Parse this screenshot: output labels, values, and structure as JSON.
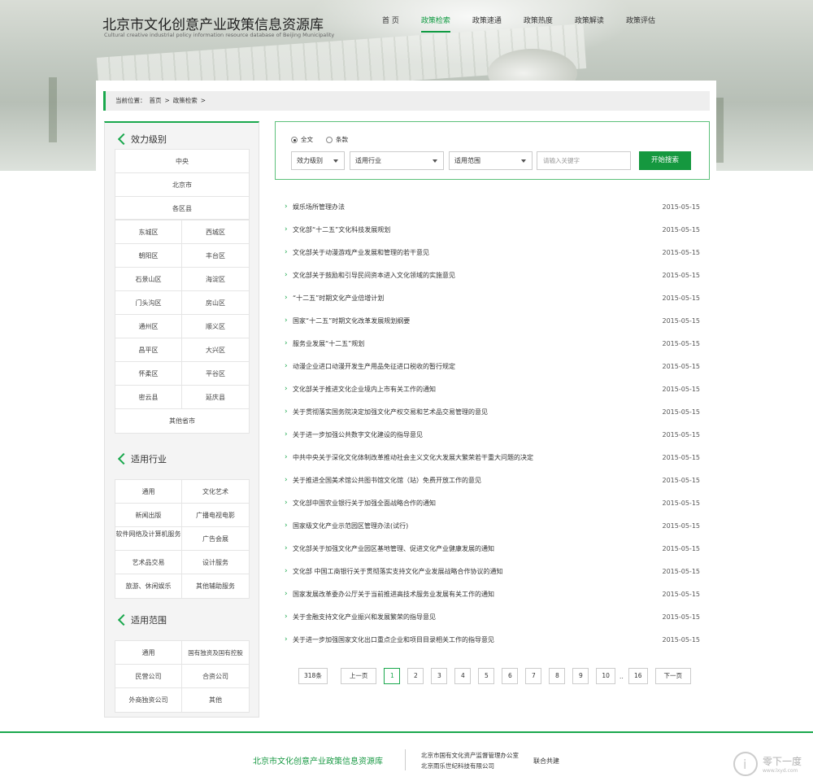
{
  "header": {
    "title": "北京市文化创意产业政策信息资源库",
    "subtitle": "Cultural creative industrial policy information resource database of Beijing Municipality",
    "nav": [
      {
        "label": "首 页",
        "active": false
      },
      {
        "label": "政策检索",
        "active": true
      },
      {
        "label": "政策速通",
        "active": false
      },
      {
        "label": "政策热度",
        "active": false
      },
      {
        "label": "政策解读",
        "active": false
      },
      {
        "label": "政策评估",
        "active": false
      }
    ]
  },
  "breadcrumb": {
    "prefix": "当前位置：",
    "home": "首页",
    "sep": ">",
    "current": "政策检索",
    "trail": ">"
  },
  "sidebar": {
    "level": {
      "heading": "效力级别",
      "top": [
        "中央",
        "北京市",
        "各区县"
      ],
      "districts": [
        "东城区",
        "西城区",
        "朝阳区",
        "丰台区",
        "石景山区",
        "海淀区",
        "门头沟区",
        "房山区",
        "通州区",
        "顺义区",
        "昌平区",
        "大兴区",
        "怀柔区",
        "平谷区",
        "密云县",
        "延庆县"
      ],
      "other": "其他省市"
    },
    "industry": {
      "heading": "适用行业",
      "items": [
        "通用",
        "文化艺术",
        "新闻出版",
        "广播电视电影",
        "软件网络及计算机服务",
        "广告会展",
        "艺术品交易",
        "设计服务",
        "旅游、休闲娱乐",
        "其他辅助服务"
      ]
    },
    "scope": {
      "heading": "适用范围",
      "items": [
        "通用",
        "国有独资及国有控股",
        "民营公司",
        "合资公司",
        "外商独资公司",
        "其他"
      ]
    }
  },
  "search": {
    "radio_full": "全文",
    "radio_article": "条款",
    "select_level": "效力级别",
    "select_industry": "适用行业",
    "select_scope": "适用范围",
    "keyword_placeholder": "请输入关键字",
    "submit": "开始搜索"
  },
  "articles": [
    {
      "title": "娱乐场所管理办法",
      "date": "2015-05-15"
    },
    {
      "title": "文化部“十二五”文化科技发展规划",
      "date": "2015-05-15"
    },
    {
      "title": "文化部关于动漫游戏产业发展和管理的若干意见",
      "date": "2015-05-15"
    },
    {
      "title": "文化部关于鼓励和引导民间资本进入文化领域的实施意见",
      "date": "2015-05-15"
    },
    {
      "title": "“十二五”时期文化产业倍增计划",
      "date": "2015-05-15"
    },
    {
      "title": "国家“十二五”时期文化改革发展规划纲要",
      "date": "2015-05-15"
    },
    {
      "title": "服务业发展“十二五”规划",
      "date": "2015-05-15"
    },
    {
      "title": "动漫企业进口动漫开发生产用品免征进口税收的暂行规定",
      "date": "2015-05-15"
    },
    {
      "title": "文化部关于推进文化企业境内上市有关工作的通知",
      "date": "2015-05-15"
    },
    {
      "title": "关于贯彻落实国务院决定加强文化产权交易和艺术品交易管理的意见",
      "date": "2015-05-15"
    },
    {
      "title": "关于进一步加强公共数字文化建设的指导意见",
      "date": "2015-05-15"
    },
    {
      "title": "中共中央关于深化文化体制改革推动社会主义文化大发展大繁荣若干重大问题的决定",
      "date": "2015-05-15"
    },
    {
      "title": "关于推进全国美术馆公共图书馆文化馆（站）免费开放工作的意见",
      "date": "2015-05-15"
    },
    {
      "title": "文化部中国农业银行关于加强全面战略合作的通知",
      "date": "2015-05-15"
    },
    {
      "title": "国家级文化产业示范园区管理办法(试行)",
      "date": "2015-05-15"
    },
    {
      "title": "文化部关于加强文化产业园区基地管理、促进文化产业健康发展的通知",
      "date": "2015-05-15"
    },
    {
      "title": "文化部 中国工商银行关于贯彻落实支持文化产业发展战略合作协议的通知",
      "date": "2015-05-15"
    },
    {
      "title": "国家发展改革委办公厅关于当前推进高技术服务业发展有关工作的通知",
      "date": "2015-05-15"
    },
    {
      "title": "关于金融支持文化产业振兴和发展繁荣的指导意见",
      "date": "2015-05-15"
    },
    {
      "title": "关于进一步加强国家文化出口重点企业和项目目录相关工作的指导意见",
      "date": "2015-05-15"
    }
  ],
  "pagination": {
    "total": "318条",
    "prev": "上一页",
    "pages": [
      "1",
      "2",
      "3",
      "4",
      "5",
      "6",
      "7",
      "8",
      "9",
      "10"
    ],
    "current": "1",
    "ellipsis": "..",
    "last": "16",
    "next": "下一页"
  },
  "footer": {
    "title": "北京市文化创意产业政策信息资源库",
    "org1": "北京市国有文化资产监督管理办公室",
    "org2": "北京雨乐世纪科技有限公司",
    "cobuild": "联合共建"
  },
  "watermark": {
    "text": "零下一度",
    "url": "www.lxyd.com"
  },
  "colors": {
    "accent": "#1aa84d",
    "button": "#15983f"
  }
}
